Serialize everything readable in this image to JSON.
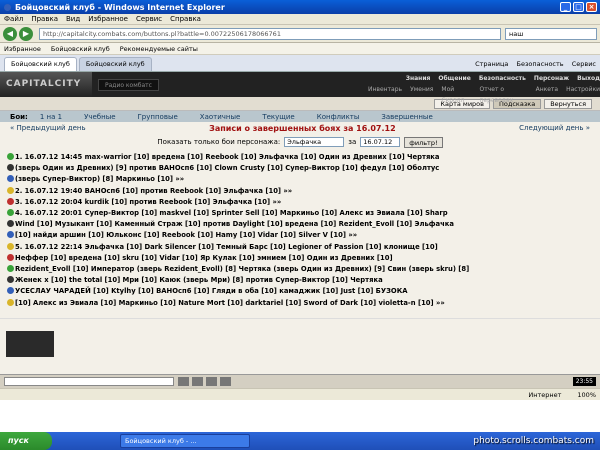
{
  "window": {
    "title": "Бойцовский клуб - Windows Internet Explorer"
  },
  "menu": [
    "Файл",
    "Правка",
    "Вид",
    "Избранное",
    "Сервис",
    "Справка"
  ],
  "address": {
    "url": "http://capitalcity.combats.com/buttons.pl?battle=0.00722506178066761",
    "search": "наш"
  },
  "favbar": {
    "favorites": "Избранное",
    "site": "Бойцовский клуб",
    "recommended": "Рекомендуемые сайты"
  },
  "tabs": [
    {
      "label": "Бойцовский клуб"
    },
    {
      "label": "Бойцовский клуб"
    }
  ],
  "tabtools": [
    "Страница",
    "Безопасность",
    "Сервис"
  ],
  "game": {
    "logo": "CAPITALCITY",
    "radio": "Радио комбатс",
    "menu_top": [
      "Знания",
      "Общение",
      "Безопасность",
      "Персонаж",
      "Выход"
    ],
    "menu_sub": [
      "Инвентарь",
      "Умения",
      "Мой Скролл",
      "Отчет о переводах",
      "Анкета",
      "Настройки"
    ]
  },
  "topnav": [
    "Карта миров",
    "Подсказка",
    "Вернуться"
  ],
  "battles": {
    "label": "Бои:",
    "items": [
      "1 на 1",
      "Учебные",
      "Групповые",
      "Хаотичные",
      "Текущие",
      "Конфликты",
      "Завершенные"
    ]
  },
  "daynav": {
    "prev": "« Предыдущий день",
    "title": "Записи о завершенных боях за 16.07.12",
    "next": "Следующий день »"
  },
  "filter": {
    "label": "Показать только бои персонажа:",
    "name": "Эльфачка",
    "for": "за",
    "date": "16.07.12",
    "button": "фильтр!"
  },
  "log_lines": [
    "1. 16.07.12 14:45 max-warrior [10] вредена [10] Reebook [10] Эльфачка [10] Один из Древних [10] Чертяка",
    "(зверь Один из Древних) [9] против ВАНОсп6 [10] Clown Crusty [10] Супер-Виктор [10] федул [10] Оболтус",
    "(зверь Супер-Виктор) [8] Маркиньо [10] »»",
    "2. 16.07.12 19:40 ВАНОсп6 [10] против Reebook [10] Эльфачка [10] »»",
    "3. 16.07.12 20:04 kurdik [10] против Reebook [10] Эльфачка [10] »»",
    "4. 16.07.12 20:01 Супер-Виктор [10] maskvel [10] Sprinter Sell [10] Маркиньо [10] Алекс из Эвиала [10] Sharp",
    "Wind [10] Музыкант [10] Каменный Страж [10] против Daylight [10] вредена [10] Rezident_Evoll [10] Эльфачка",
    "[10] найди аршин [10] Юльконс [10] Reebook [10] Hamy [10] Vidar [10] Silver V [10] »»",
    "5. 16.07.12 22:14 Эльфачка [10] Dark Silencer [10] Темный Барс [10] Legioner of Passion [10] клонище [10]",
    "Неффер [10] вредена [10] skru [10] Vidar [10] Яр Кулак [10] эмнием [10] Один из Древних [10]",
    "Rezident_Evoll [10] Император (зверь Rezident_Evoll) [8] Чертяка (зверь Один из Древних) [9] Свин (зверь skru) [8]",
    "Женек х [10] the total [10] Мри [10] Каюк (зверь Мри) [8] против Супер-Виктор [10] Чертяка",
    "УСЕСЛАУ ЧАРАДЕЙ [10] Ktylhy [10] ВАНОсп6 [10] Гляди в оба [10] камаджик [10] Just [10] БУЗОКА",
    "[10] Алекс из Эвиала [10] Маркиньо [10] Nature Mort [10] darktariel [10] Sword of Dark [10] violetta-n [10] »»"
  ],
  "status": {
    "text": "",
    "zone": "Интернет",
    "zoom": "100%"
  },
  "tray": {
    "clock": "23:55"
  },
  "taskbar": {
    "start": "пуск",
    "task": "Бойцовский клуб - ...",
    "watermark": "photo.scrolls.combats.com"
  }
}
